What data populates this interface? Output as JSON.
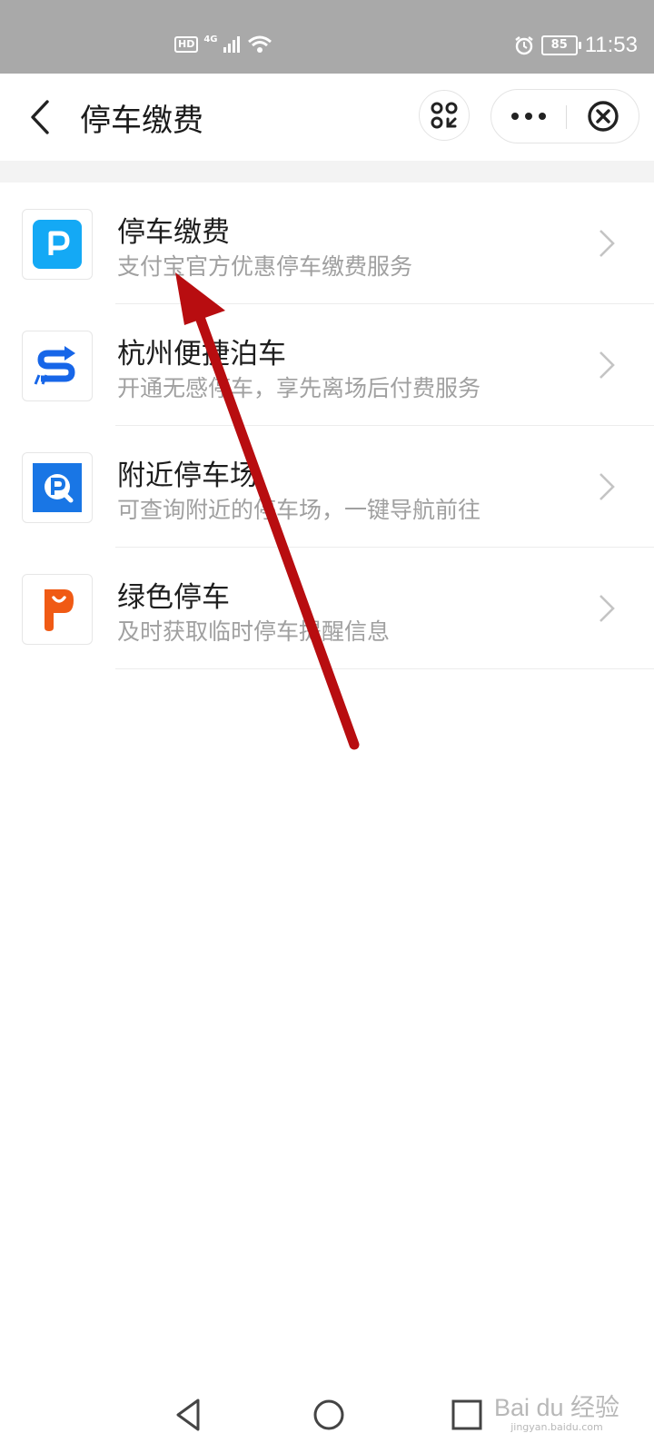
{
  "status_bar": {
    "hd": "HD",
    "network": "4G",
    "battery": "85",
    "time": "11:53"
  },
  "header": {
    "title": "停车缴费"
  },
  "services": [
    {
      "title": "停车缴费",
      "desc": "支付宝官方优惠停车缴费服务",
      "icon": "parking-p-icon",
      "color": "#14a9f5"
    },
    {
      "title": "杭州便捷泊车",
      "desc": "开通无感停车，享先离场后付费服务",
      "icon": "s-arrow-icon",
      "color": "#1766e8"
    },
    {
      "title": "附近停车场",
      "desc": "可查询附近的停车场，一键导航前往",
      "icon": "parking-search-icon",
      "color": "#1976e5"
    },
    {
      "title": "绿色停车",
      "desc": "及时获取临时停车提醒信息",
      "icon": "smile-p-icon",
      "color": "#f05a14"
    }
  ],
  "annotation": {
    "color": "#b80d10"
  },
  "watermark": {
    "brand": "Bai du 经验",
    "url": "jingyan.baidu.com"
  }
}
